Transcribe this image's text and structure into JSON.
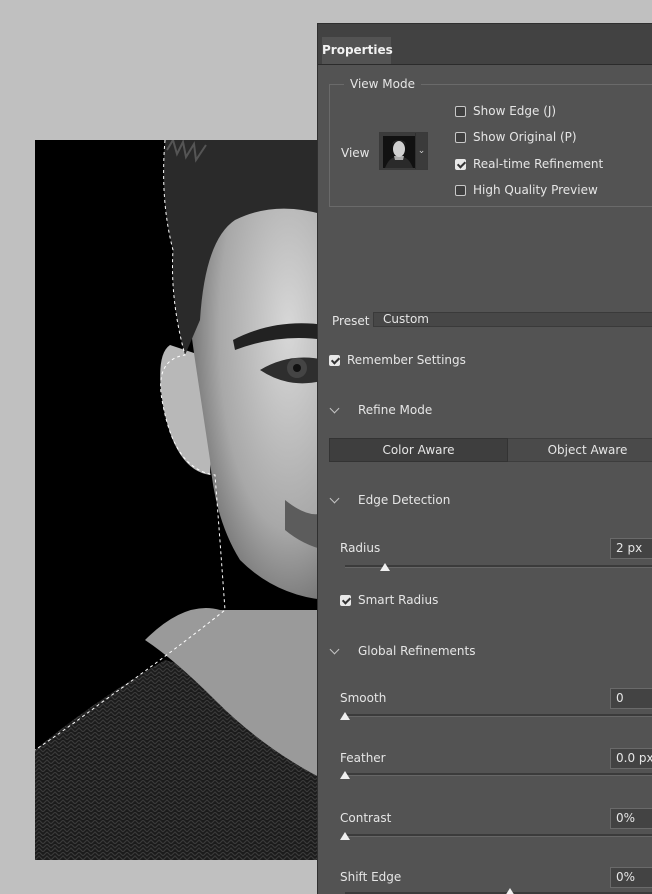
{
  "panel": {
    "tab_label": "Properties",
    "view_mode": {
      "legend": "View Mode",
      "view_label": "View",
      "options": [
        {
          "label": "Show Edge (J)",
          "checked": false
        },
        {
          "label": "Show Original (P)",
          "checked": false
        },
        {
          "label": "Real-time Refinement",
          "checked": true
        },
        {
          "label": "High Quality Preview",
          "checked": false
        }
      ]
    },
    "preset": {
      "label": "Preset",
      "value": "Custom"
    },
    "remember_settings": {
      "label": "Remember Settings",
      "checked": true
    },
    "refine_mode": {
      "heading": "Refine Mode",
      "options": [
        "Color Aware",
        "Object Aware"
      ],
      "selected": "Color Aware"
    },
    "edge_detection": {
      "heading": "Edge Detection",
      "radius": {
        "label": "Radius",
        "value": "2 px",
        "level": 0.12
      },
      "smart_radius": {
        "label": "Smart Radius",
        "checked": true
      }
    },
    "global_refinements": {
      "heading": "Global Refinements",
      "sliders": [
        {
          "key": "smooth",
          "label": "Smooth",
          "value": "0",
          "level": 0
        },
        {
          "key": "feather",
          "label": "Feather",
          "value": "0.0 px",
          "level": 0
        },
        {
          "key": "contrast",
          "label": "Contrast",
          "value": "0%",
          "level": 0
        },
        {
          "key": "shift_edge",
          "label": "Shift Edge",
          "value": "0%",
          "level": 0.5
        }
      ]
    }
  },
  "icons": {
    "view_thumbnail": "portrait-thumbnail-icon",
    "dropdown": "chevron-down-icon",
    "section_toggle": "chevron-down-icon",
    "checkbox": "checkmark-icon"
  },
  "colors": {
    "panel_bg": "#535353",
    "tab_bar_bg": "#424242",
    "workspace_bg": "#c0c0c0"
  }
}
